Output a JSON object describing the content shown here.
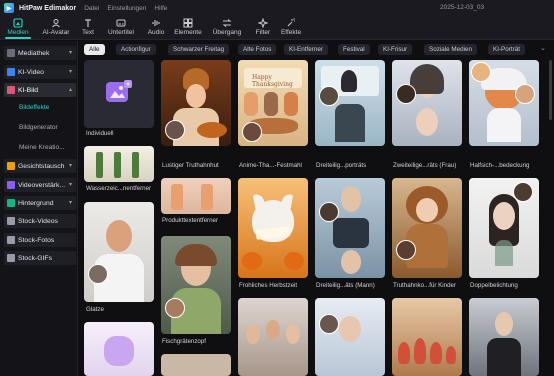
{
  "app": {
    "title": "HitPaw Edimakor",
    "document_title": "2025-12-03_03"
  },
  "menu": [
    "Datei",
    "Einstellungen",
    "Hilfe"
  ],
  "toolbar": [
    {
      "label": "Medien",
      "icon": "media-icon",
      "active": true
    },
    {
      "label": "AI-Avatar",
      "icon": "avatar-icon",
      "active": false
    },
    {
      "label": "Text",
      "icon": "text-icon",
      "active": false
    },
    {
      "label": "Untertitel",
      "icon": "subtitle-icon",
      "active": false
    },
    {
      "label": "Audio",
      "icon": "audio-icon",
      "active": false
    },
    {
      "label": "Elemente",
      "icon": "elements-icon",
      "active": false
    },
    {
      "label": "Übergang",
      "icon": "transition-icon",
      "active": false
    },
    {
      "label": "Filter",
      "icon": "filter-icon",
      "active": false
    },
    {
      "label": "Effekte",
      "icon": "effects-icon",
      "active": false
    }
  ],
  "sidebar": {
    "items": [
      {
        "label": "Mediathek",
        "icon": "folder-icon",
        "chevron": "▾"
      },
      {
        "label": "KI-Video",
        "icon": "ai-video-icon",
        "chevron": "▾"
      },
      {
        "label": "KI-Bild",
        "icon": "ai-image-icon",
        "chevron": "▴"
      },
      {
        "label": "Gesichtstausch",
        "icon": "face-swap-icon",
        "chevron": "▾"
      },
      {
        "label": "Videoverstärk...",
        "icon": "enhance-icon",
        "chevron": "▾"
      },
      {
        "label": "Hintergrund",
        "icon": "background-icon",
        "chevron": "▾"
      },
      {
        "label": "Stock-Videos",
        "icon": "stock-video-icon",
        "chevron": ""
      },
      {
        "label": "Stock-Fotos",
        "icon": "stock-photo-icon",
        "chevron": ""
      },
      {
        "label": "Stock-GIFs",
        "icon": "stock-gif-icon",
        "chevron": ""
      }
    ],
    "subitems": [
      "Bildeffekte",
      "Bildgenerator",
      "Meine Kreatio..."
    ]
  },
  "chips": [
    "Alle",
    "Actionfigur",
    "Schwarzer Freitag",
    "Alte Fotos",
    "KI-Entferner",
    "Festival",
    "KI-Frisur",
    "Soziale Medien",
    "KI-Porträt"
  ],
  "chips_more": "⌄",
  "cards": [
    "Individuell",
    "Lustiger Truthahnhut",
    "Anime-Tha...-Festmahl",
    "Dreiteilig...porträts",
    "Zweiteilige...räts (Frau)",
    "Halfsich-...bedeckung",
    "Wasserzeic...nentferner",
    "Produkttextentferner",
    "Frohliches Herbstzeit",
    "Dreiteilig...äts (Mann)",
    "Truthahnko...für Kinder",
    "Doppelbelichtung",
    "Glatze",
    "Fischgrätenzopf"
  ],
  "sticker_text": "Happy Thanksgiving",
  "colors": {
    "accent": "#26d3c6",
    "bg": "#0f0f12",
    "panel": "#1a1a20"
  }
}
